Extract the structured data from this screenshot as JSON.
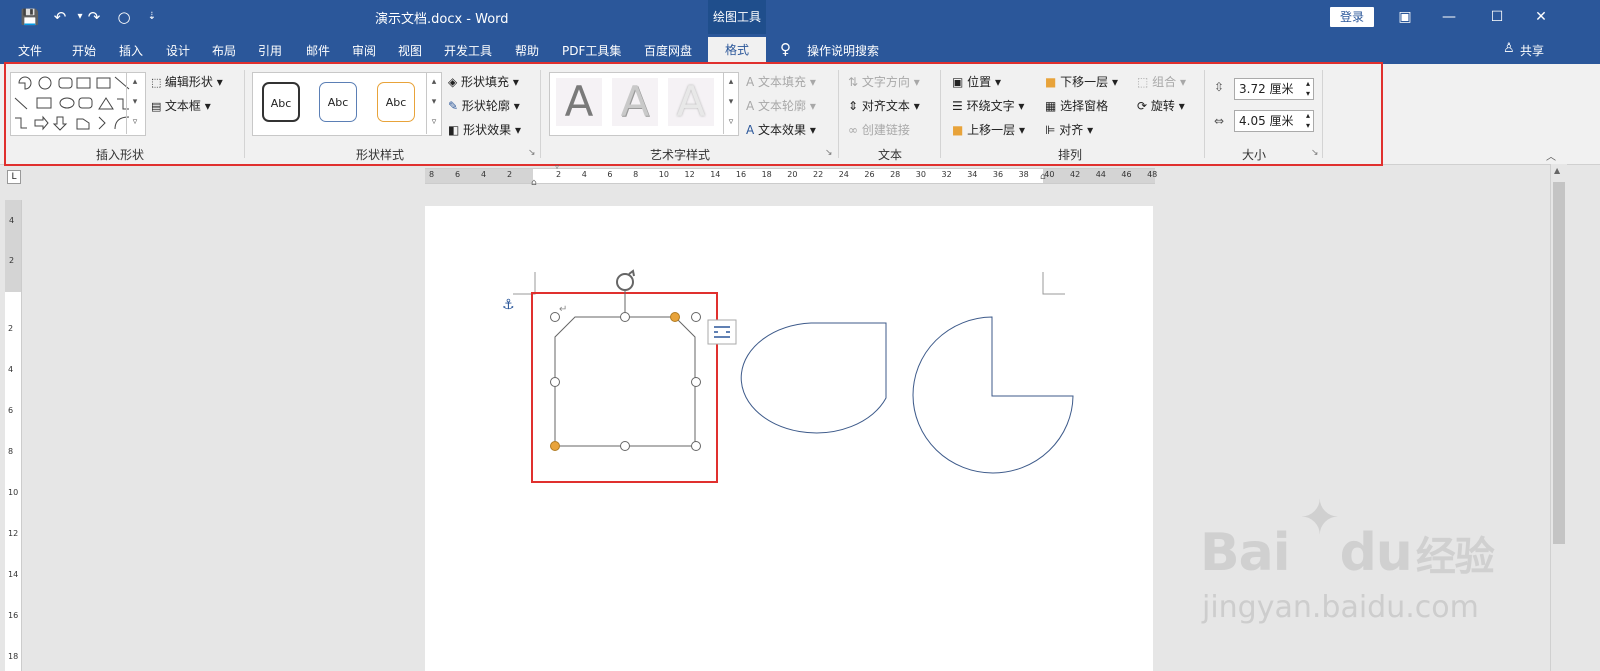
{
  "titlebar": {
    "doc_title": "演示文档.docx  -  Word",
    "context_tool": "绘图工具",
    "login": "登录",
    "qa_save": "💾",
    "qa_undo": "↶",
    "qa_redo": "↷"
  },
  "tabs": [
    "文件",
    "开始",
    "插入",
    "设计",
    "布局",
    "引用",
    "邮件",
    "审阅",
    "视图",
    "开发工具",
    "帮助",
    "PDF工具集",
    "百度网盘"
  ],
  "active_tab": "格式",
  "tell_me": "操作说明搜索",
  "share": "共享",
  "ribbon": {
    "insert_shapes": {
      "label": "插入形状",
      "edit_shape": "编辑形状",
      "text_box": "文本框"
    },
    "shape_styles": {
      "label": "形状样式",
      "previews": [
        "Abc",
        "Abc",
        "Abc"
      ],
      "fill": "形状填充",
      "outline": "形状轮廓",
      "effects": "形状效果"
    },
    "wordart": {
      "label": "艺术字样式",
      "letters": [
        "A",
        "A",
        "A"
      ],
      "text_fill": "文本填充",
      "text_outline": "文本轮廓",
      "text_effects": "文本效果"
    },
    "text": {
      "label": "文本",
      "direction": "文字方向",
      "align": "对齐文本",
      "link": "创建链接"
    },
    "arrange": {
      "label": "排列",
      "position": "位置",
      "wrap": "环绕文字",
      "forward": "上移一层",
      "backward": "下移一层",
      "selection_pane": "选择窗格",
      "align": "对齐",
      "group": "组合",
      "rotate": "旋转"
    },
    "size": {
      "label": "大小",
      "height": "3.72 厘米",
      "width": "4.05 厘米"
    }
  },
  "ruler": {
    "h_left": [
      "8",
      "6",
      "4",
      "2"
    ],
    "h_right": [
      "2",
      "4",
      "6",
      "8",
      "10",
      "12",
      "14",
      "16",
      "18",
      "20",
      "22",
      "24",
      "26",
      "28",
      "30",
      "32",
      "34",
      "36",
      "38",
      "40",
      "42",
      "44",
      "46",
      "48"
    ],
    "v_top": [
      "4",
      "2"
    ],
    "v_bottom": [
      "2",
      "4",
      "6",
      "8",
      "10",
      "12",
      "14",
      "16",
      "18"
    ]
  },
  "colors": {
    "titlebar": "#2b579a",
    "selection_box": "#e0302e",
    "handle_yellow": "#e8a33a",
    "shape_stroke": "#3d5a8a"
  },
  "watermark": {
    "brand": "Bai",
    "brand_suffix": "du",
    "cn": "经验",
    "url": "jingyan.baidu.com"
  }
}
